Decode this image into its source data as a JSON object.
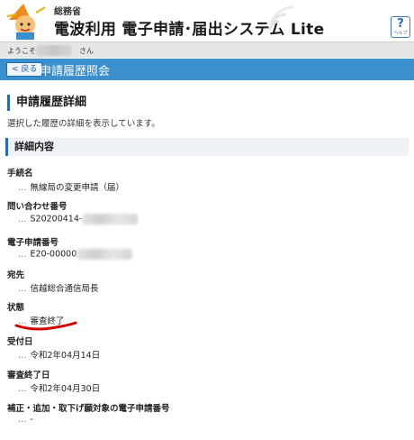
{
  "header": {
    "ministry": "総務省",
    "app_title": "電波利用 電子申請･届出システム Lite",
    "help_mark": "?",
    "help_label": "ヘルプ"
  },
  "welcome": {
    "prefix": "ようこそ",
    "suffix": "さん"
  },
  "title_bar": {
    "back_label": "< 戻る",
    "page_title": "申請履歴照会"
  },
  "section": {
    "title": "申請履歴詳細",
    "description": "選択した履歴の詳細を表示しています。",
    "sub_title": "詳細内容"
  },
  "fields": [
    {
      "label": "手続名",
      "value": "無線局の変更申請（届）"
    },
    {
      "label": "問い合わせ番号",
      "value": "S20200414-"
    },
    {
      "label": "電子申請番号",
      "value": "E20-00000"
    },
    {
      "label": "宛先",
      "value": "信越総合通信局長"
    },
    {
      "label": "状態",
      "value": "審査終了"
    },
    {
      "label": "受付日",
      "value": "令和2年04月14日"
    },
    {
      "label": "審査終了日",
      "value": "令和2年04月30日"
    },
    {
      "label": "補正・追加・取下げ願対象の電子申請番号",
      "value": "-"
    }
  ],
  "dots": "…",
  "colors": {
    "accent": "#3a8fce",
    "border_accent": "#2a6bb0",
    "annotation": "#d40000"
  }
}
